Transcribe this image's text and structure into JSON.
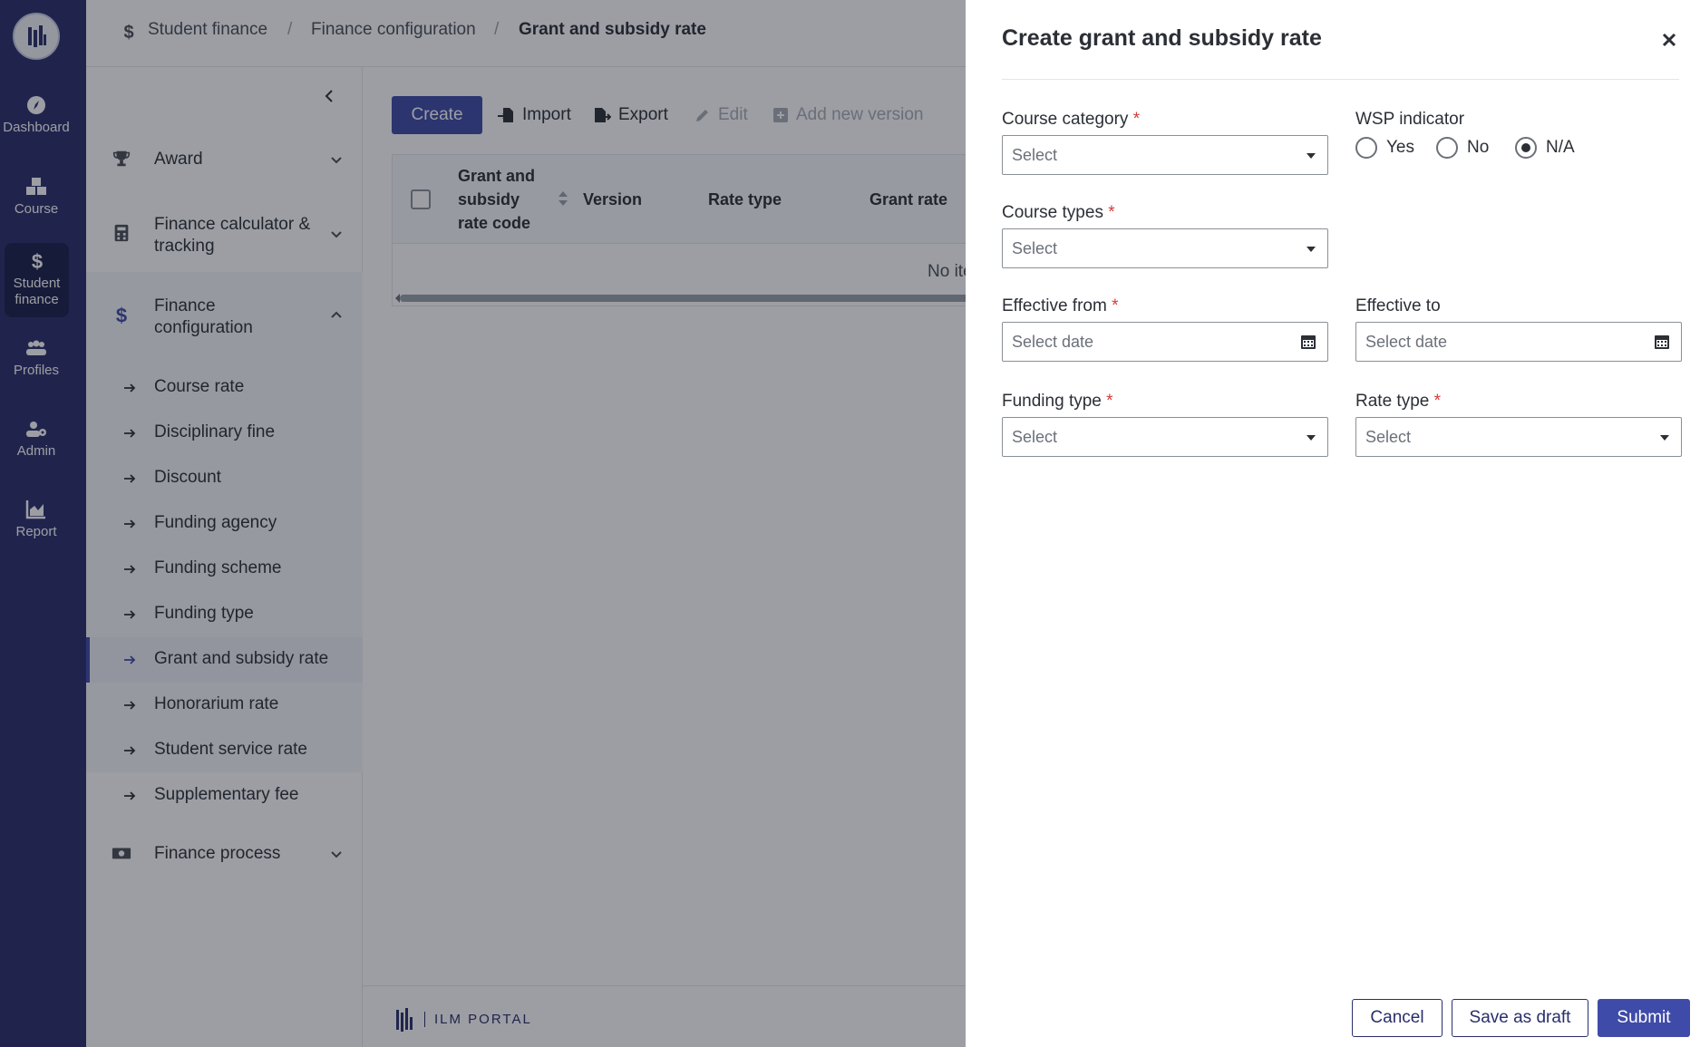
{
  "rail": {
    "items": [
      {
        "label": "Dashboard",
        "icon": "compass-icon"
      },
      {
        "label": "Course",
        "icon": "cubes-icon"
      },
      {
        "label": "Student finance",
        "icon": "dollar-icon"
      },
      {
        "label": "Profiles",
        "icon": "users-icon"
      },
      {
        "label": "Admin",
        "icon": "user-cog-icon"
      },
      {
        "label": "Report",
        "icon": "chart-icon"
      }
    ],
    "active_label_1": "Student",
    "active_label_2": "finance"
  },
  "breadcrumb": {
    "items": [
      "Student finance",
      "Finance configuration",
      "Grant and subsidy rate"
    ],
    "separator": "/"
  },
  "sidenav": {
    "groups": [
      {
        "label_1": "Award",
        "label_2": "",
        "icon": "trophy-icon"
      },
      {
        "label_1": "Finance calculator &",
        "label_2": "tracking",
        "icon": "calculator-icon"
      },
      {
        "label_1": "Finance",
        "label_2": "configuration",
        "icon": "dollar-icon"
      },
      {
        "label_1": "Finance process",
        "label_2": "",
        "icon": "money-bill-icon"
      }
    ],
    "sub_items": [
      "Course rate",
      "Disciplinary fine",
      "Discount",
      "Funding agency",
      "Funding scheme",
      "Funding type",
      "Grant and subsidy rate",
      "Honorarium rate",
      "Student service rate",
      "Supplementary fee"
    ]
  },
  "toolbar": {
    "create": "Create",
    "import": "Import",
    "export": "Export",
    "edit": "Edit",
    "add_new_version": "Add new version"
  },
  "grid": {
    "col1_line1": "Grant and",
    "col1_line2": "subsidy",
    "col1_line3": "rate code",
    "col2": "Version",
    "col3": "Rate type",
    "col4": "Grant rate",
    "empty": "No ite"
  },
  "footer": {
    "brand": "ILM PORTAL"
  },
  "drawer": {
    "title": "Create grant and subsidy rate",
    "course_category": {
      "label": "Course category",
      "required": "*",
      "placeholder": "Select"
    },
    "wsp_indicator": {
      "label": "WSP indicator",
      "options": [
        "Yes",
        "No",
        "N/A"
      ],
      "selected": "N/A"
    },
    "course_types": {
      "label": "Course types",
      "required": "*",
      "placeholder": "Select"
    },
    "effective_from": {
      "label": "Effective from",
      "required": "*",
      "placeholder": "Select date"
    },
    "effective_to": {
      "label": "Effective to",
      "placeholder": "Select date"
    },
    "funding_type": {
      "label": "Funding type",
      "required": "*",
      "placeholder": "Select"
    },
    "rate_type": {
      "label": "Rate type",
      "required": "*",
      "placeholder": "Select"
    },
    "cancel": "Cancel",
    "save_draft": "Save as draft",
    "submit": "Submit"
  },
  "colors": {
    "rail": "#2a2e6b",
    "primary": "#3f4ba8",
    "required": "#d63a3a"
  }
}
